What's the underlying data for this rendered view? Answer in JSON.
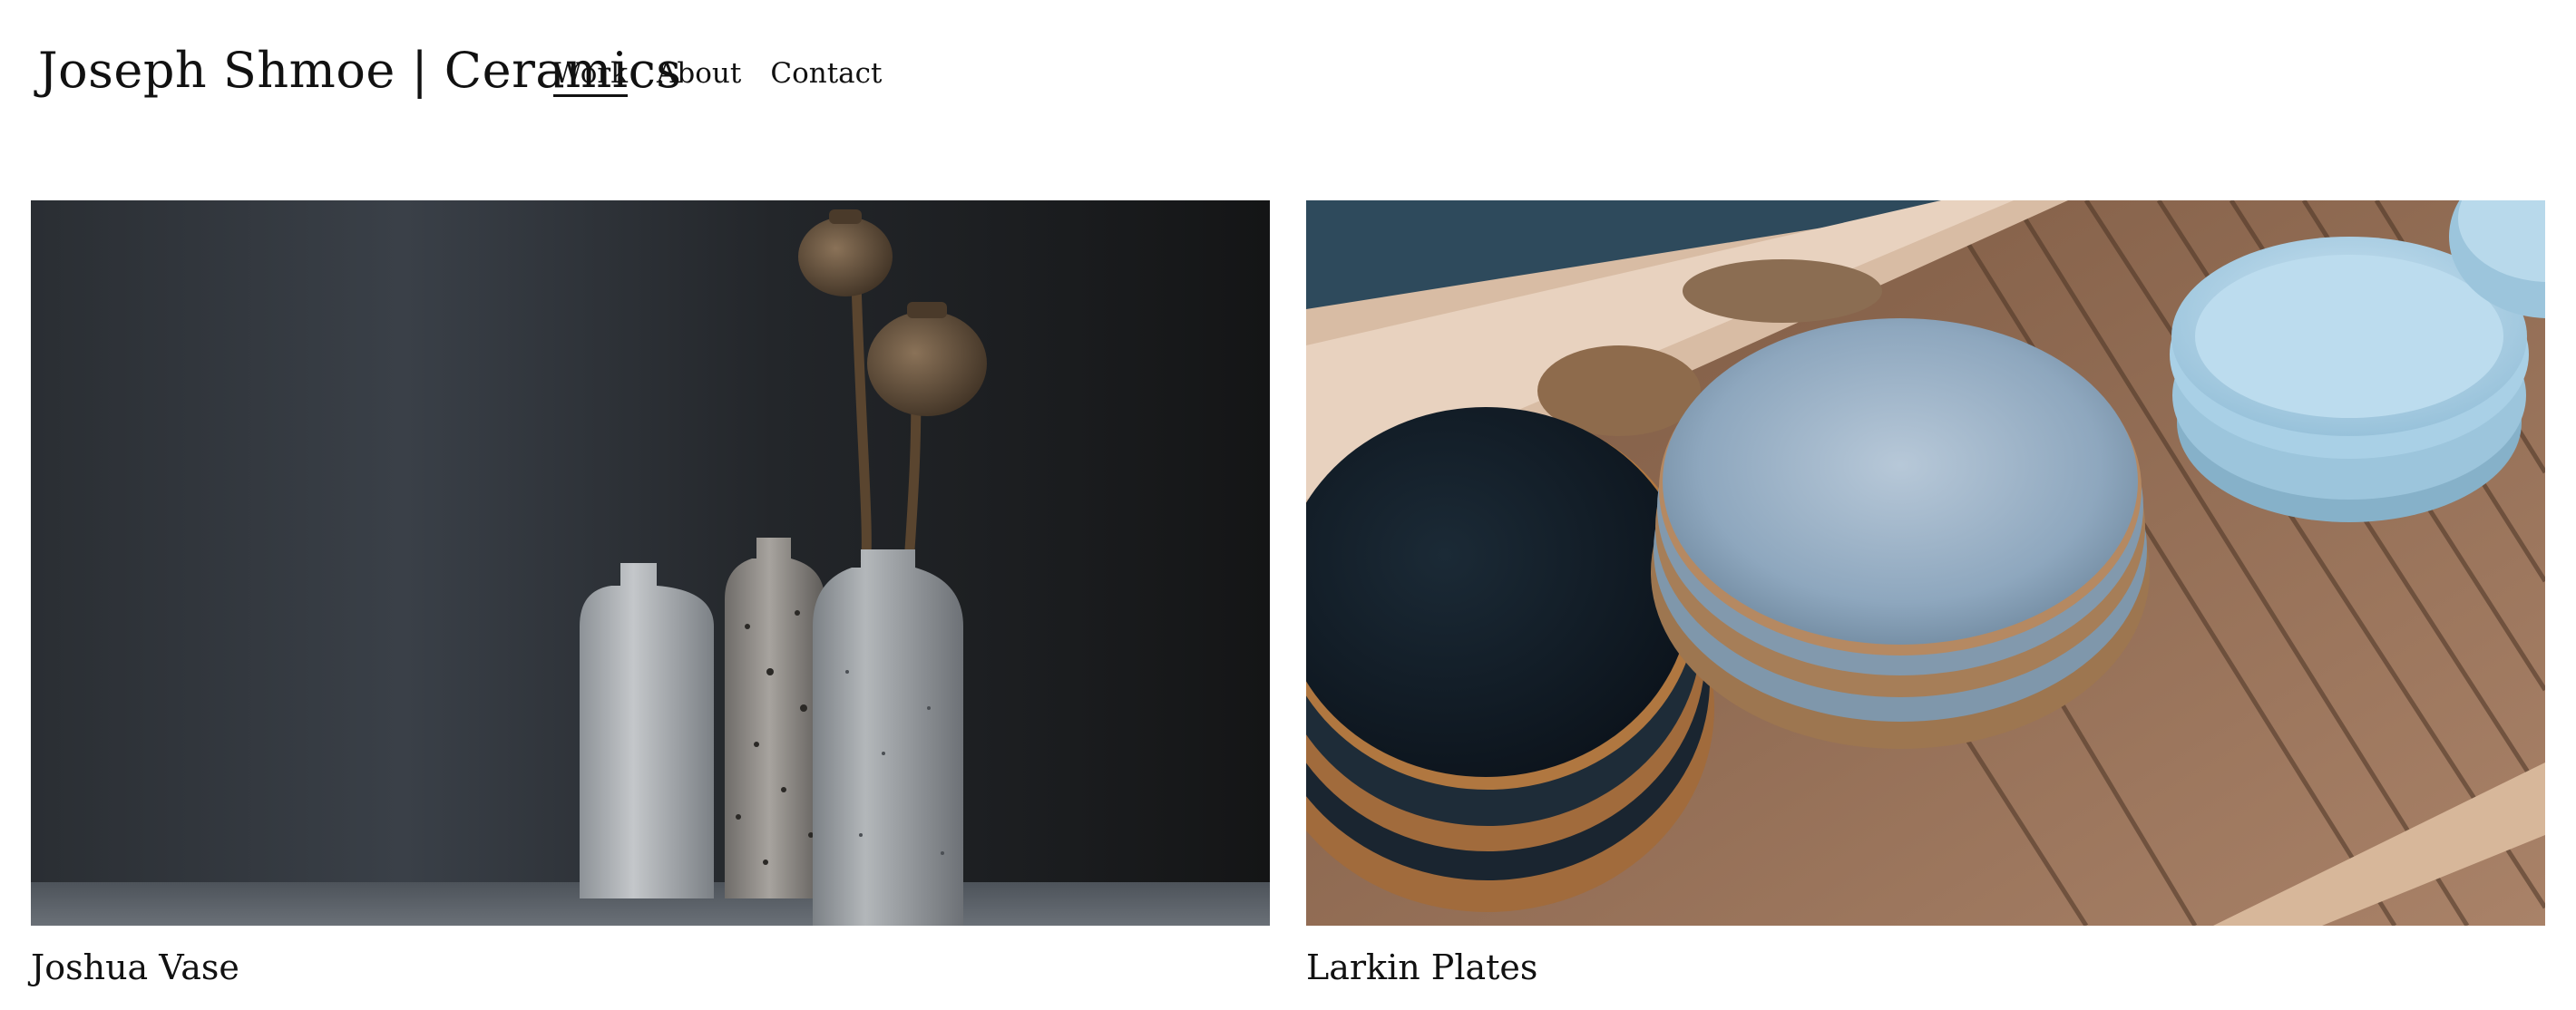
{
  "site": {
    "title": "Joseph Shmoe | Ceramics"
  },
  "nav": {
    "items": [
      {
        "label": "Work",
        "active": true
      },
      {
        "label": "About",
        "active": false
      },
      {
        "label": "Contact",
        "active": false
      }
    ]
  },
  "gallery": {
    "items": [
      {
        "title": "Joshua Vase"
      },
      {
        "title": "Larkin Plates"
      }
    ]
  }
}
